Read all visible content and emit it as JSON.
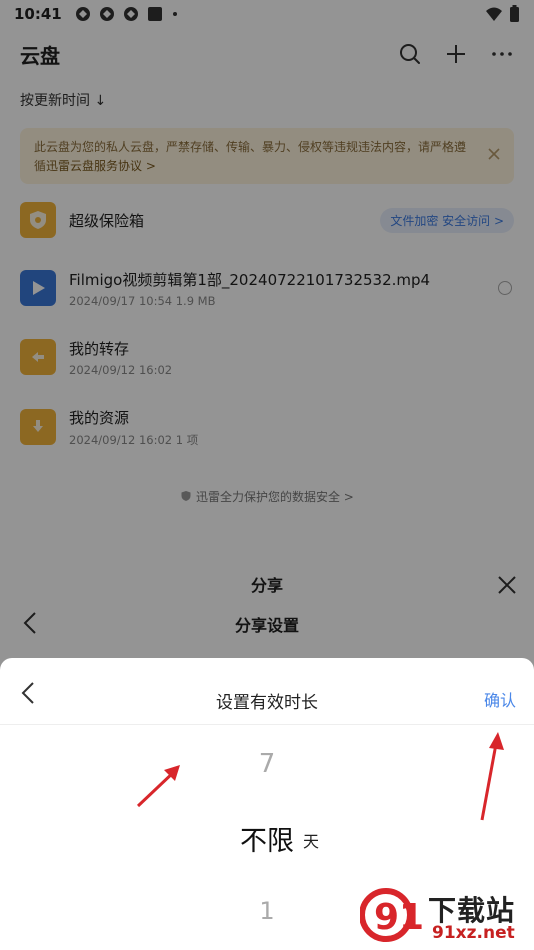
{
  "status_bar": {
    "time": "10:41",
    "icons": [
      "sync-icon",
      "sync-icon",
      "sync-icon",
      "square-icon",
      "dot-icon"
    ],
    "right_icons": [
      "wifi-icon",
      "battery-icon"
    ]
  },
  "app_bar": {
    "title": "云盘",
    "actions": [
      "search-icon",
      "plus-icon",
      "more-icon"
    ]
  },
  "sort_label": "按更新时间",
  "sort_arrow": "↓",
  "notice": {
    "text": "此云盘为您的私人云盘，严禁存储、传输、暴力、侵权等违规违法内容，请严格遵循",
    "link": "迅雷云盘服务协议 >"
  },
  "files": [
    {
      "name": "超级保险箱",
      "icon": "safe-icon",
      "tag": "文件加密 安全访问 >"
    },
    {
      "name": "Filmigo视频剪辑第1部_20240722101732532.mp4",
      "meta": "2024/09/17 10:54   1.9 MB",
      "icon": "video-play-icon"
    },
    {
      "name": "我的转存",
      "meta": "2024/09/12 16:02",
      "icon": "folder-transfer-icon"
    },
    {
      "name": "我的资源",
      "meta": "2024/09/12 16:02   1 项",
      "icon": "folder-download-icon"
    }
  ],
  "footer_note": "迅雷全力保护您的数据安全 >",
  "share_sheet": {
    "title": "分享",
    "subtitle": "分享设置"
  },
  "duration_sheet": {
    "title": "设置有效时长",
    "confirm": "确认",
    "picker": {
      "previous": "7",
      "selected": "不限",
      "next": "1",
      "unit": "天"
    }
  },
  "watermark": {
    "logo_text": "91",
    "brand": "下载站",
    "site": "91xz.net"
  },
  "colors": {
    "accent": "#4a87e8",
    "notice_bg": "#fdf3dd",
    "folder": "#f2b43c",
    "video": "#3a78d8",
    "annotation_arrow": "#d8262b"
  }
}
